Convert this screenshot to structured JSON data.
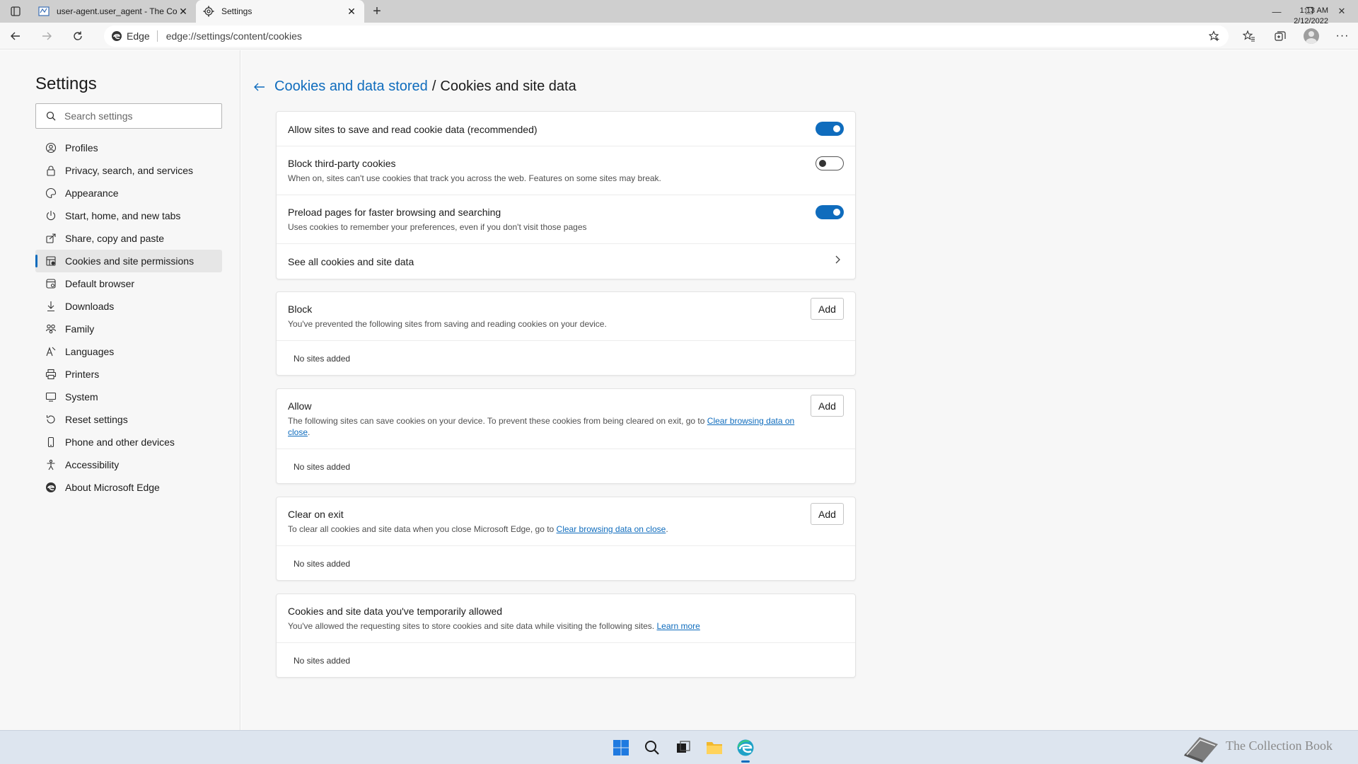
{
  "tabs": [
    {
      "title": "user-agent.user_agent - The Col",
      "active": false
    },
    {
      "title": "Settings",
      "active": true
    }
  ],
  "address": {
    "site_label": "Edge",
    "url": "edge://settings/content/cookies"
  },
  "sidebar": {
    "title": "Settings",
    "search_placeholder": "Search settings",
    "items": [
      {
        "label": "Profiles",
        "icon": "profile-icon"
      },
      {
        "label": "Privacy, search, and services",
        "icon": "lock-icon"
      },
      {
        "label": "Appearance",
        "icon": "palette-icon"
      },
      {
        "label": "Start, home, and new tabs",
        "icon": "power-icon"
      },
      {
        "label": "Share, copy and paste",
        "icon": "share-icon"
      },
      {
        "label": "Cookies and site permissions",
        "icon": "cookie-grid-icon",
        "selected": true
      },
      {
        "label": "Default browser",
        "icon": "browser-icon"
      },
      {
        "label": "Downloads",
        "icon": "download-icon"
      },
      {
        "label": "Family",
        "icon": "family-icon"
      },
      {
        "label": "Languages",
        "icon": "language-icon"
      },
      {
        "label": "Printers",
        "icon": "printer-icon"
      },
      {
        "label": "System",
        "icon": "system-icon"
      },
      {
        "label": "Reset settings",
        "icon": "reset-icon"
      },
      {
        "label": "Phone and other devices",
        "icon": "phone-icon"
      },
      {
        "label": "Accessibility",
        "icon": "accessibility-icon"
      },
      {
        "label": "About Microsoft Edge",
        "icon": "edge-icon"
      }
    ]
  },
  "breadcrumb": {
    "parent": "Cookies and data stored",
    "separator": "/",
    "current": "Cookies and site data"
  },
  "settings_card": {
    "allow_save": {
      "title": "Allow sites to save and read cookie data (recommended)",
      "on": true
    },
    "block_third_party": {
      "title": "Block third-party cookies",
      "desc": "When on, sites can't use cookies that track you across the web. Features on some sites may break.",
      "on": false
    },
    "preload": {
      "title": "Preload pages for faster browsing and searching",
      "desc": "Uses cookies to remember your preferences, even if you don't visit those pages",
      "on": true
    },
    "see_all": {
      "title": "See all cookies and site data"
    }
  },
  "block_card": {
    "title": "Block",
    "desc": "You've prevented the following sites from saving and reading cookies on your device.",
    "add_label": "Add",
    "empty": "No sites added"
  },
  "allow_card": {
    "title": "Allow",
    "desc_prefix": "The following sites can save cookies on your device. To prevent these cookies from being cleared on exit, go to ",
    "link": "Clear browsing data on close",
    "desc_suffix": ".",
    "add_label": "Add",
    "empty": "No sites added"
  },
  "clear_card": {
    "title": "Clear on exit",
    "desc_prefix": "To clear all cookies and site data when you close Microsoft Edge, go to ",
    "link": "Clear browsing data on close",
    "desc_suffix": ".",
    "add_label": "Add",
    "empty": "No sites added"
  },
  "temp_card": {
    "title": "Cookies and site data you've temporarily allowed",
    "desc_prefix": "You've allowed the requesting sites to store cookies and site data while visiting the following sites. ",
    "link": "Learn more",
    "empty": "No sites added"
  },
  "taskbar": {
    "time": "1:13 AM",
    "date": "2/12/2022",
    "watermark": "The Collection Book"
  },
  "colors": {
    "accent": "#0f6cbd",
    "taskbar": "#dde5ef"
  }
}
